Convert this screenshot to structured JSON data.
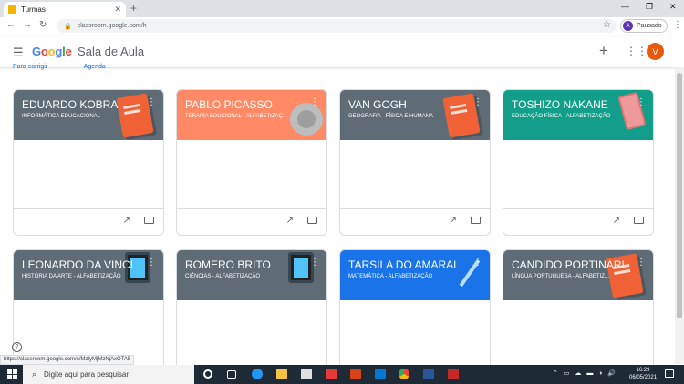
{
  "browser": {
    "tab_title": "Turmas",
    "url": "classroom.google.com/h",
    "profile_initial": "A",
    "profile_label": "Pausado",
    "status_url": "https://classroom.google.com/c/MzIyMjMzNjAxOTA5"
  },
  "app": {
    "brand_google": "Google",
    "brand_product": "Sala de Aula",
    "user_initial": "V",
    "subnav": [
      "Para corrigir",
      "Agenda"
    ]
  },
  "courses": [
    {
      "title": "EDUARDO KOBRA",
      "subtitle": "INFORMÁTICA EDUCACIONAL",
      "color": "#5f6c76",
      "deco": "book"
    },
    {
      "title": "PABLO PICASSO",
      "subtitle": "TERAPIA EDUCIONAL - ALFABETIZAÇ...",
      "color": "#ff8a65",
      "deco": "palette"
    },
    {
      "title": "VAN GOGH",
      "subtitle": "GEOGRAFIA - FÍSICA E HUMANA",
      "color": "#5f6c76",
      "deco": "book"
    },
    {
      "title": "TOSHIZO NAKANE",
      "subtitle": "EDUCAÇÃO FÍSICA - ALFABETIZAÇÃO",
      "color": "#129e8a",
      "deco": "phone"
    },
    {
      "title": "LEONARDO DA VINCI",
      "subtitle": "HISTÓRIA DA ARTE - ALFABETIZAÇÃO",
      "color": "#5f6c76",
      "deco": "tablet"
    },
    {
      "title": "ROMERO BRITO",
      "subtitle": "CIÊNCIAS - ALFABETIZAÇÃO",
      "color": "#5f6c76",
      "deco": "tablet"
    },
    {
      "title": "TARSILA DO AMARAL",
      "subtitle": "MATEMÁTICA - ALFABETIZAÇÃO",
      "color": "#1a73e8",
      "deco": "pencil"
    },
    {
      "title": "CANDIDO PORTINARI",
      "subtitle": "LÍNGUA PORTUGUESA - ALFABETIZ...",
      "color": "#5f6c76",
      "deco": "book"
    }
  ],
  "taskbar": {
    "search_placeholder": "Digite aqui para pesquisar",
    "time": "16:29",
    "date": "06/05/2021"
  }
}
